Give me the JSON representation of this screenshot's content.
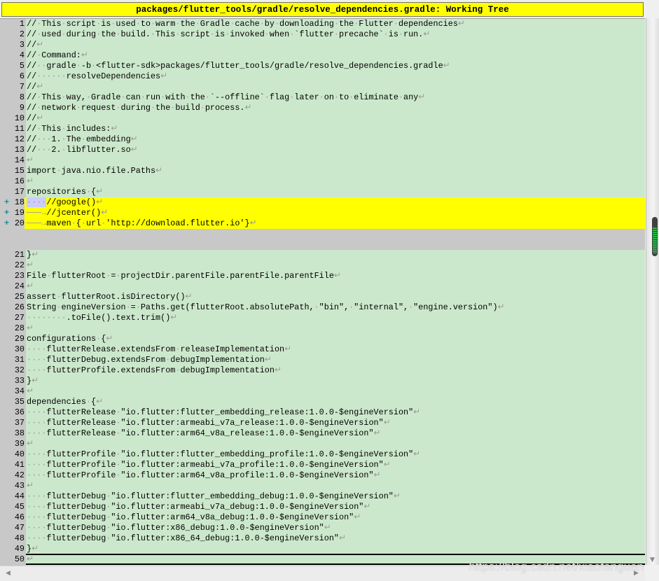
{
  "window": {
    "title": "packages/flutter_tools/gradle/resolve_dependencies.gradle: Working Tree"
  },
  "colors": {
    "added_line": "#ffff00",
    "background": "#cce8cc",
    "gutter": "#c8c8c8",
    "added_marker": "#1f8aa0"
  },
  "lines": [
    {
      "n": "1",
      "text": "// This script is used to warm the Gradle cache by downloading the Flutter dependencies"
    },
    {
      "n": "2",
      "text": "// used during the build. This script is invoked when `flutter precache` is run."
    },
    {
      "n": "3",
      "text": "//"
    },
    {
      "n": "4",
      "text": "// Command:"
    },
    {
      "n": "5",
      "text": "//  gradle -b <flutter-sdk>packages/flutter_tools/gradle/resolve_dependencies.gradle"
    },
    {
      "n": "6",
      "text": "//      resolveDependencies"
    },
    {
      "n": "7",
      "text": "//"
    },
    {
      "n": "8",
      "text": "// This way, Gradle can run with the `--offline` flag later on to eliminate any"
    },
    {
      "n": "9",
      "text": "// network request during the build process."
    },
    {
      "n": "10",
      "text": "//"
    },
    {
      "n": "11",
      "text": "// This includes:"
    },
    {
      "n": "12",
      "text": "//   1. The embedding"
    },
    {
      "n": "13",
      "text": "//   2. libflutter.so"
    },
    {
      "n": "14",
      "text": ""
    },
    {
      "n": "15",
      "text": "import java.nio.file.Paths"
    },
    {
      "n": "16",
      "text": ""
    },
    {
      "n": "17",
      "text": "repositories {"
    },
    {
      "n": "18",
      "text": "    //google()",
      "added": true
    },
    {
      "n": "19",
      "text": "\t//jcenter()",
      "added": true
    },
    {
      "n": "20",
      "text": "\tmaven { url 'http://download.flutter.io'}",
      "added": true
    },
    {
      "gap": true
    },
    {
      "n": "21",
      "text": "}"
    },
    {
      "n": "22",
      "text": ""
    },
    {
      "n": "23",
      "text": "File flutterRoot = projectDir.parentFile.parentFile.parentFile"
    },
    {
      "n": "24",
      "text": ""
    },
    {
      "n": "25",
      "text": "assert flutterRoot.isDirectory()"
    },
    {
      "n": "26",
      "text": "String engineVersion = Paths.get(flutterRoot.absolutePath, \"bin\", \"internal\", \"engine.version\")"
    },
    {
      "n": "27",
      "text": "        .toFile().text.trim()"
    },
    {
      "n": "28",
      "text": ""
    },
    {
      "n": "29",
      "text": "configurations {"
    },
    {
      "n": "30",
      "text": "    flutterRelease.extendsFrom releaseImplementation"
    },
    {
      "n": "31",
      "text": "    flutterDebug.extendsFrom debugImplementation"
    },
    {
      "n": "32",
      "text": "    flutterProfile.extendsFrom debugImplementation"
    },
    {
      "n": "33",
      "text": "}"
    },
    {
      "n": "34",
      "text": ""
    },
    {
      "n": "35",
      "text": "dependencies {"
    },
    {
      "n": "36",
      "text": "    flutterRelease \"io.flutter:flutter_embedding_release:1.0.0-$engineVersion\""
    },
    {
      "n": "37",
      "text": "    flutterRelease \"io.flutter:armeabi_v7a_release:1.0.0-$engineVersion\""
    },
    {
      "n": "38",
      "text": "    flutterRelease \"io.flutter:arm64_v8a_release:1.0.0-$engineVersion\""
    },
    {
      "n": "39",
      "text": ""
    },
    {
      "n": "40",
      "text": "    flutterProfile \"io.flutter:flutter_embedding_profile:1.0.0-$engineVersion\""
    },
    {
      "n": "41",
      "text": "    flutterProfile \"io.flutter:armeabi_v7a_profile:1.0.0-$engineVersion\""
    },
    {
      "n": "42",
      "text": "    flutterProfile \"io.flutter:arm64_v8a_profile:1.0.0-$engineVersion\""
    },
    {
      "n": "43",
      "text": ""
    },
    {
      "n": "44",
      "text": "    flutterDebug \"io.flutter:flutter_embedding_debug:1.0.0-$engineVersion\""
    },
    {
      "n": "45",
      "text": "    flutterDebug \"io.flutter:armeabi_v7a_debug:1.0.0-$engineVersion\""
    },
    {
      "n": "46",
      "text": "    flutterDebug \"io.flutter:arm64_v8a_debug:1.0.0-$engineVersion\""
    },
    {
      "n": "47",
      "text": "    flutterDebug \"io.flutter:x86_debug:1.0.0-$engineVersion\""
    },
    {
      "n": "48",
      "text": "    flutterDebug \"io.flutter:x86_64_debug:1.0.0-$engineVersion\""
    },
    {
      "n": "49",
      "text": "}"
    },
    {
      "n": "50",
      "text": ""
    }
  ],
  "watermark": "https://blog.csdn.net/xiaofanguan"
}
